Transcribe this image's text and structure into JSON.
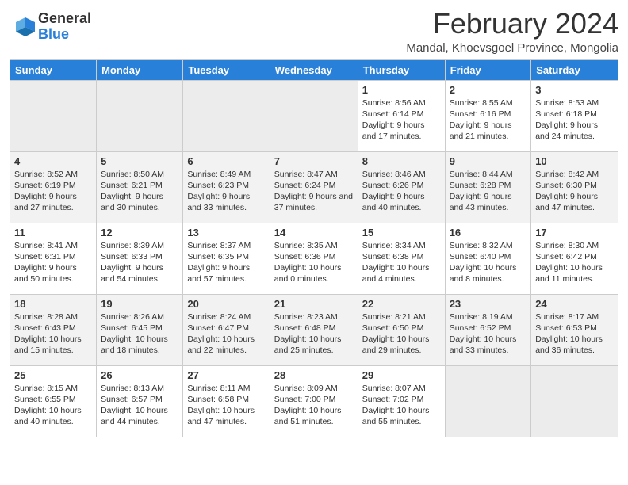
{
  "logo": {
    "general": "General",
    "blue": "Blue"
  },
  "title": "February 2024",
  "subtitle": "Mandal, Khoevsgoel Province, Mongolia",
  "days_of_week": [
    "Sunday",
    "Monday",
    "Tuesday",
    "Wednesday",
    "Thursday",
    "Friday",
    "Saturday"
  ],
  "weeks": [
    [
      {
        "day": "",
        "info": ""
      },
      {
        "day": "",
        "info": ""
      },
      {
        "day": "",
        "info": ""
      },
      {
        "day": "",
        "info": ""
      },
      {
        "day": "1",
        "info": "Sunrise: 8:56 AM\nSunset: 6:14 PM\nDaylight: 9 hours\nand 17 minutes."
      },
      {
        "day": "2",
        "info": "Sunrise: 8:55 AM\nSunset: 6:16 PM\nDaylight: 9 hours\nand 21 minutes."
      },
      {
        "day": "3",
        "info": "Sunrise: 8:53 AM\nSunset: 6:18 PM\nDaylight: 9 hours\nand 24 minutes."
      }
    ],
    [
      {
        "day": "4",
        "info": "Sunrise: 8:52 AM\nSunset: 6:19 PM\nDaylight: 9 hours\nand 27 minutes."
      },
      {
        "day": "5",
        "info": "Sunrise: 8:50 AM\nSunset: 6:21 PM\nDaylight: 9 hours\nand 30 minutes."
      },
      {
        "day": "6",
        "info": "Sunrise: 8:49 AM\nSunset: 6:23 PM\nDaylight: 9 hours\nand 33 minutes."
      },
      {
        "day": "7",
        "info": "Sunrise: 8:47 AM\nSunset: 6:24 PM\nDaylight: 9 hours\nand 37 minutes."
      },
      {
        "day": "8",
        "info": "Sunrise: 8:46 AM\nSunset: 6:26 PM\nDaylight: 9 hours\nand 40 minutes."
      },
      {
        "day": "9",
        "info": "Sunrise: 8:44 AM\nSunset: 6:28 PM\nDaylight: 9 hours\nand 43 minutes."
      },
      {
        "day": "10",
        "info": "Sunrise: 8:42 AM\nSunset: 6:30 PM\nDaylight: 9 hours\nand 47 minutes."
      }
    ],
    [
      {
        "day": "11",
        "info": "Sunrise: 8:41 AM\nSunset: 6:31 PM\nDaylight: 9 hours\nand 50 minutes."
      },
      {
        "day": "12",
        "info": "Sunrise: 8:39 AM\nSunset: 6:33 PM\nDaylight: 9 hours\nand 54 minutes."
      },
      {
        "day": "13",
        "info": "Sunrise: 8:37 AM\nSunset: 6:35 PM\nDaylight: 9 hours\nand 57 minutes."
      },
      {
        "day": "14",
        "info": "Sunrise: 8:35 AM\nSunset: 6:36 PM\nDaylight: 10 hours\nand 0 minutes."
      },
      {
        "day": "15",
        "info": "Sunrise: 8:34 AM\nSunset: 6:38 PM\nDaylight: 10 hours\nand 4 minutes."
      },
      {
        "day": "16",
        "info": "Sunrise: 8:32 AM\nSunset: 6:40 PM\nDaylight: 10 hours\nand 8 minutes."
      },
      {
        "day": "17",
        "info": "Sunrise: 8:30 AM\nSunset: 6:42 PM\nDaylight: 10 hours\nand 11 minutes."
      }
    ],
    [
      {
        "day": "18",
        "info": "Sunrise: 8:28 AM\nSunset: 6:43 PM\nDaylight: 10 hours\nand 15 minutes."
      },
      {
        "day": "19",
        "info": "Sunrise: 8:26 AM\nSunset: 6:45 PM\nDaylight: 10 hours\nand 18 minutes."
      },
      {
        "day": "20",
        "info": "Sunrise: 8:24 AM\nSunset: 6:47 PM\nDaylight: 10 hours\nand 22 minutes."
      },
      {
        "day": "21",
        "info": "Sunrise: 8:23 AM\nSunset: 6:48 PM\nDaylight: 10 hours\nand 25 minutes."
      },
      {
        "day": "22",
        "info": "Sunrise: 8:21 AM\nSunset: 6:50 PM\nDaylight: 10 hours\nand 29 minutes."
      },
      {
        "day": "23",
        "info": "Sunrise: 8:19 AM\nSunset: 6:52 PM\nDaylight: 10 hours\nand 33 minutes."
      },
      {
        "day": "24",
        "info": "Sunrise: 8:17 AM\nSunset: 6:53 PM\nDaylight: 10 hours\nand 36 minutes."
      }
    ],
    [
      {
        "day": "25",
        "info": "Sunrise: 8:15 AM\nSunset: 6:55 PM\nDaylight: 10 hours\nand 40 minutes."
      },
      {
        "day": "26",
        "info": "Sunrise: 8:13 AM\nSunset: 6:57 PM\nDaylight: 10 hours\nand 44 minutes."
      },
      {
        "day": "27",
        "info": "Sunrise: 8:11 AM\nSunset: 6:58 PM\nDaylight: 10 hours\nand 47 minutes."
      },
      {
        "day": "28",
        "info": "Sunrise: 8:09 AM\nSunset: 7:00 PM\nDaylight: 10 hours\nand 51 minutes."
      },
      {
        "day": "29",
        "info": "Sunrise: 8:07 AM\nSunset: 7:02 PM\nDaylight: 10 hours\nand 55 minutes."
      },
      {
        "day": "",
        "info": ""
      },
      {
        "day": "",
        "info": ""
      }
    ]
  ]
}
